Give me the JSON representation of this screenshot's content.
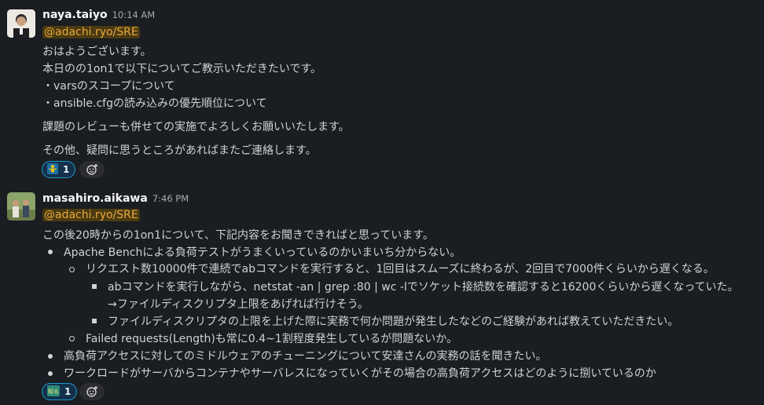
{
  "messages": [
    {
      "author": "naya.taiyo",
      "time": "10:14 AM",
      "mention": "@adachi.ryo/SRE",
      "lines": [
        "おはようございます。",
        "本日のの1on1で以下についてご教示いただきたいです。",
        "・varsのスコープについて",
        "・ansible.cfgの読み込みの優先順位について",
        "課題のレビューも併せての実施でよろしくお願いいたします。",
        "その他、疑問に思うところがあればまたご連絡します。"
      ],
      "reaction": {
        "icon": "person-icon",
        "count": "1"
      }
    },
    {
      "author": "masahiro.aikawa",
      "time": "7:46 PM",
      "mention": "@adachi.ryo/SRE",
      "intro": "この後20時からの1on1について、下記内容をお聞きできればと思っています。",
      "bullets": [
        "Apache Benchによる負荷テストがうまくいっているのかいまいち分からない。",
        "リクエスト数10000件で連続でabコマンドを実行すると、1回目はスムーズに終わるが、2回目で7000件くらいから遅くなる。",
        "abコマンドを実行しながら、netstat -an | grep :80 | wc -lでソケット接続数を確認すると16200くらいから遅くなっていた。",
        "→ファイルディスクリプタ上限をあげれば行けそう。",
        "ファイルディスクリプタの上限を上げた際に実務で何か問題が発生したなどのご経験があれば教えていただきたい。",
        "Failed requests(Length)も常に0.4~1割程度発生しているが問題ないか。",
        "高負荷アクセスに対してのミドルウェアのチューニングについて安達さんの実務の話を聞きたい。",
        "ワークロードがサーバからコンテナやサーバレスになっていくがその場合の高負荷アクセスはどのように捌いているのか"
      ],
      "reaction": {
        "icon": "chishiki-icon",
        "label": "知る",
        "count": "1"
      }
    }
  ],
  "colors": {
    "background": "#1a1d21",
    "mention": "#e8a83a",
    "reaction": "#1d9bd1"
  }
}
